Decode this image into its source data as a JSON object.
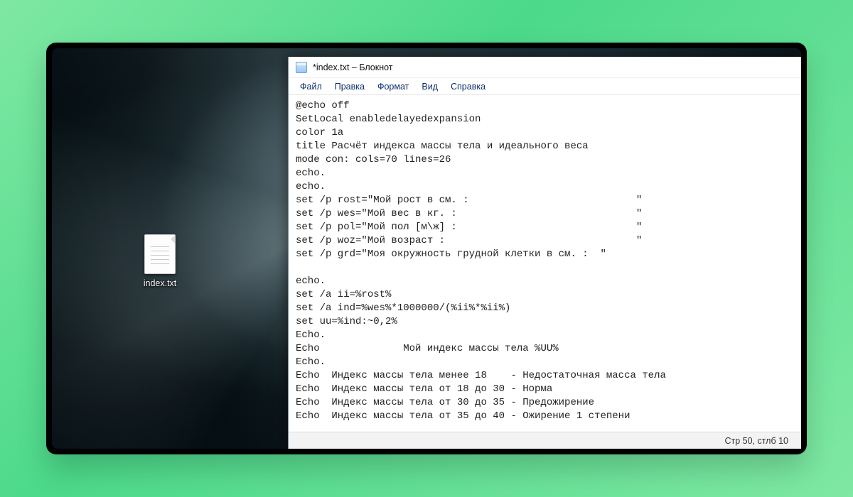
{
  "desktop": {
    "icon_label": "index.txt"
  },
  "notepad": {
    "title": "*index.txt – Блокнот",
    "menu": {
      "file": "Файл",
      "edit": "Правка",
      "format": "Формат",
      "view": "Вид",
      "help": "Справка"
    },
    "content": "@echo off\nSetLocal enabledelayedexpansion\ncolor 1a\ntitle Расчёт индекса массы тела и идеального веса\nmode con: cols=70 lines=26\necho.\necho.\nset /p rost=\"Мой рост в см. :                            \"\nset /p wes=\"Мой вес в кг. :                              \"\nset /p pol=\"Мой пол [м\\ж] :                              \"\nset /p woz=\"Мой возраст :                                \"\nset /p grd=\"Моя окружность грудной клетки в см. :  \"\n\necho.\nset /a ii=%rost%\nset /a ind=%wes%*1000000/(%ii%*%ii%)\nset uu=%ind:~0,2%\nEcho.\nEcho              Мой индекс массы тела %UU%\nEcho.\nEcho  Индекс массы тела менее 18    - Недостаточная масса тела\nEcho  Индекс массы тела от 18 до 30 - Норма\nEcho  Индекс массы тела от 30 до 35 - Предожирение\nEcho  Индекс массы тела от 35 до 40 - Ожирение 1 степени",
    "status": "Стр 50, стлб 10"
  }
}
